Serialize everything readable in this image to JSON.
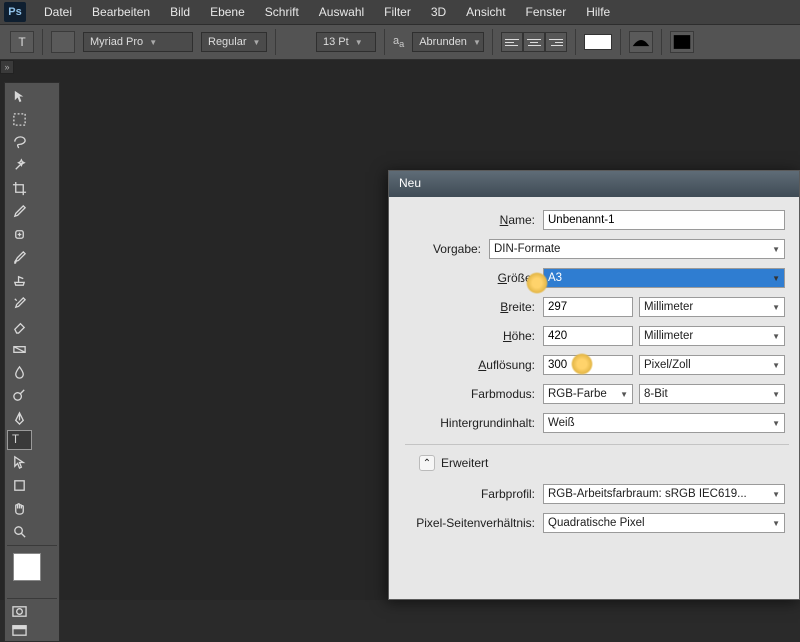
{
  "app": {
    "logo": "Ps"
  },
  "menu": [
    "Datei",
    "Bearbeiten",
    "Bild",
    "Ebene",
    "Schrift",
    "Auswahl",
    "Filter",
    "3D",
    "Ansicht",
    "Fenster",
    "Hilfe"
  ],
  "options": {
    "font": "Myriad Pro",
    "weight": "Regular",
    "size": "13 Pt",
    "aa": "Abrunden"
  },
  "dialog": {
    "title": "Neu",
    "name_label": "Name:",
    "name_value": "Unbenannt-1",
    "preset_label": "Vorgabe:",
    "preset_value": "DIN-Formate",
    "size_label": "Größe:",
    "size_value": "A3",
    "width_label": "Breite:",
    "width_value": "297",
    "width_unit": "Millimeter",
    "height_label": "Höhe:",
    "height_value": "420",
    "height_unit": "Millimeter",
    "res_label": "Auflösung:",
    "res_value": "300",
    "res_unit": "Pixel/Zoll",
    "mode_label": "Farbmodus:",
    "mode_value": "RGB-Farbe",
    "depth_value": "8-Bit",
    "bg_label": "Hintergrundinhalt:",
    "bg_value": "Weiß",
    "advanced": "Erweitert",
    "profile_label": "Farbprofil:",
    "profile_value": "RGB-Arbeitsfarbraum: sRGB IEC619...",
    "aspect_label": "Pixel-Seitenverhältnis:",
    "aspect_value": "Quadratische Pixel"
  }
}
